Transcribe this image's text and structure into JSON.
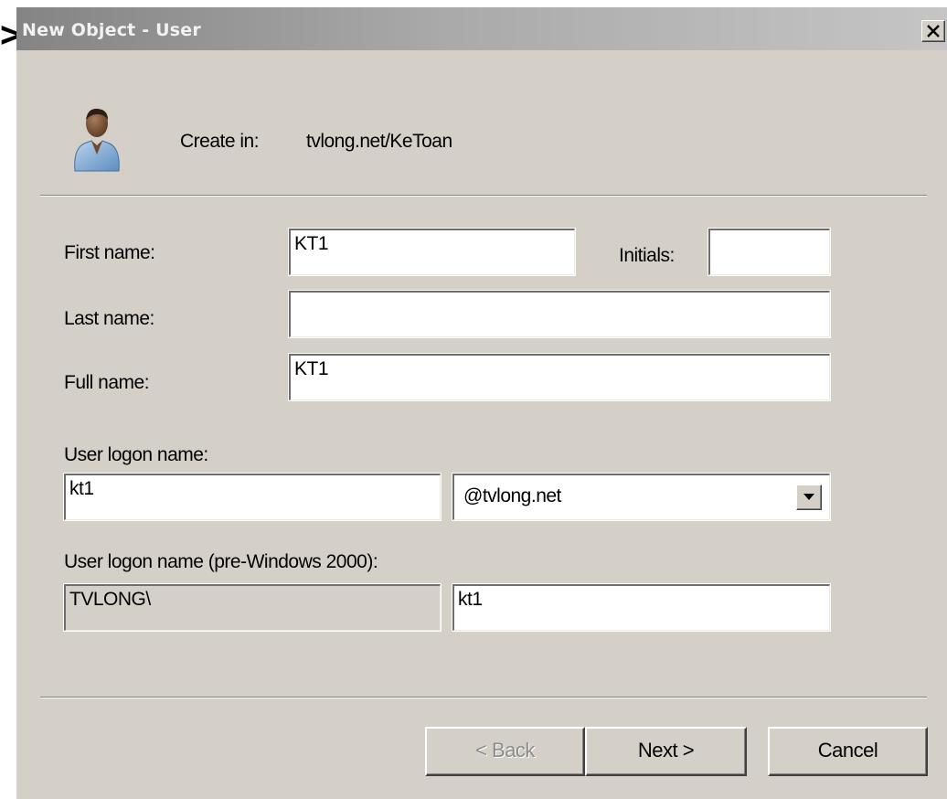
{
  "stray_glyph": ">",
  "window": {
    "title": "New Object - User",
    "close_glyph": "x"
  },
  "header": {
    "icon": "user-icon",
    "create_in_label": "Create in:",
    "create_in_value": "tvlong.net/KeToan"
  },
  "form": {
    "first_name_label": "First name:",
    "first_name_value": "KT1",
    "initials_label": "Initials:",
    "initials_value": "",
    "last_name_label": "Last name:",
    "last_name_value": "",
    "full_name_label": "Full name:",
    "full_name_value": "KT1",
    "logon_name_label": "User logon name:",
    "logon_name_value": "kt1",
    "domain_selected": "@tvlong.net",
    "pre2000_label": "User logon name (pre-Windows 2000):",
    "pre2000_domain_value": "TVLONG\\",
    "pre2000_name_value": "kt1"
  },
  "buttons": {
    "back_label": "< Back",
    "next_label": "Next >",
    "cancel_label": "Cancel"
  },
  "colors": {
    "dialog_face": "#d4d0c8",
    "titlebar_inactive": "#a9a9a9",
    "disabled_text": "#8c8c8c"
  }
}
